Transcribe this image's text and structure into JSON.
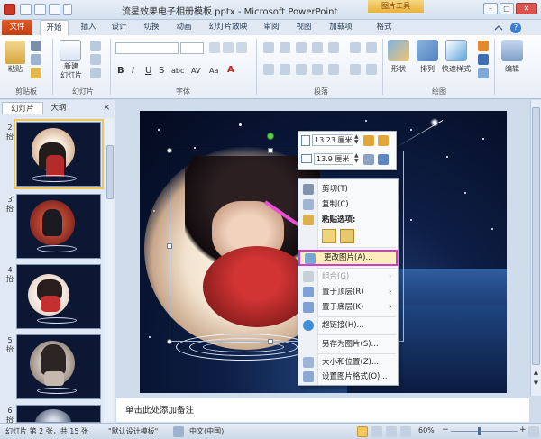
{
  "window": {
    "title": "流星效果电子相册模板.pptx - Microsoft PowerPoint",
    "contextual_tab_group": "图片工具"
  },
  "tabs": [
    "文件",
    "开始",
    "插入",
    "设计",
    "切换",
    "动画",
    "幻灯片放映",
    "审阅",
    "视图",
    "加载项",
    "格式"
  ],
  "active_tab": "开始",
  "ribbon": {
    "clipboard": {
      "paste": "粘贴",
      "label": "剪贴板"
    },
    "slides": {
      "new_slide": "新建\n幻灯片",
      "label": "幻灯片"
    },
    "font": {
      "label": "字体",
      "bold": "B",
      "italic": "I",
      "underline": "U",
      "strike": "S",
      "shadow": "abc",
      "spacing": "AV",
      "case": "Aa",
      "color": "A"
    },
    "paragraph": {
      "label": "段落"
    },
    "drawing": {
      "label": "绘图",
      "shapes": "形状",
      "arrange": "排列",
      "quick_styles": "快速样式"
    },
    "editing": {
      "edit": "编辑"
    }
  },
  "left_pane": {
    "tabs": [
      "幻灯片",
      "大纲"
    ],
    "close": "×",
    "slides": [
      {
        "num": "2",
        "suffix": "抬"
      },
      {
        "num": "3",
        "suffix": "抬"
      },
      {
        "num": "4",
        "suffix": "抬"
      },
      {
        "num": "5",
        "suffix": "抬"
      },
      {
        "num": "6",
        "suffix": "抬"
      }
    ]
  },
  "mini_toolbar": {
    "height_value": "13.23 厘米",
    "width_value": "13.9 厘米"
  },
  "context_menu": {
    "items": [
      {
        "label": "剪切(T)",
        "disabled": false
      },
      {
        "label": "复制(C)",
        "disabled": false
      },
      {
        "label": "粘贴选项:",
        "disabled": false,
        "header": true
      },
      {
        "label": "更改图片(A)...",
        "disabled": false,
        "highlight": true
      },
      {
        "label": "组合(G)",
        "disabled": true,
        "submenu": true
      },
      {
        "label": "置于顶层(R)",
        "disabled": false,
        "submenu": true
      },
      {
        "label": "置于底层(K)",
        "disabled": false,
        "submenu": true
      },
      {
        "label": "超链接(H)...",
        "disabled": false
      },
      {
        "label": "另存为图片(S)...",
        "disabled": false
      },
      {
        "label": "大小和位置(Z)...",
        "disabled": false
      },
      {
        "label": "设置图片格式(O)...",
        "disabled": false
      }
    ]
  },
  "notes": {
    "placeholder": "单击此处添加备注"
  },
  "status_bar": {
    "slide_info": "幻灯片 第 2 张，共 15 张",
    "theme": "\"默认设计模板\"",
    "language": "中文(中国)",
    "zoom": "60%"
  },
  "colors": {
    "highlight_box": "#d43ad0",
    "arrow": "#e84fd6",
    "file_tab": "#d2481b",
    "contextual": "#e9b23d"
  }
}
